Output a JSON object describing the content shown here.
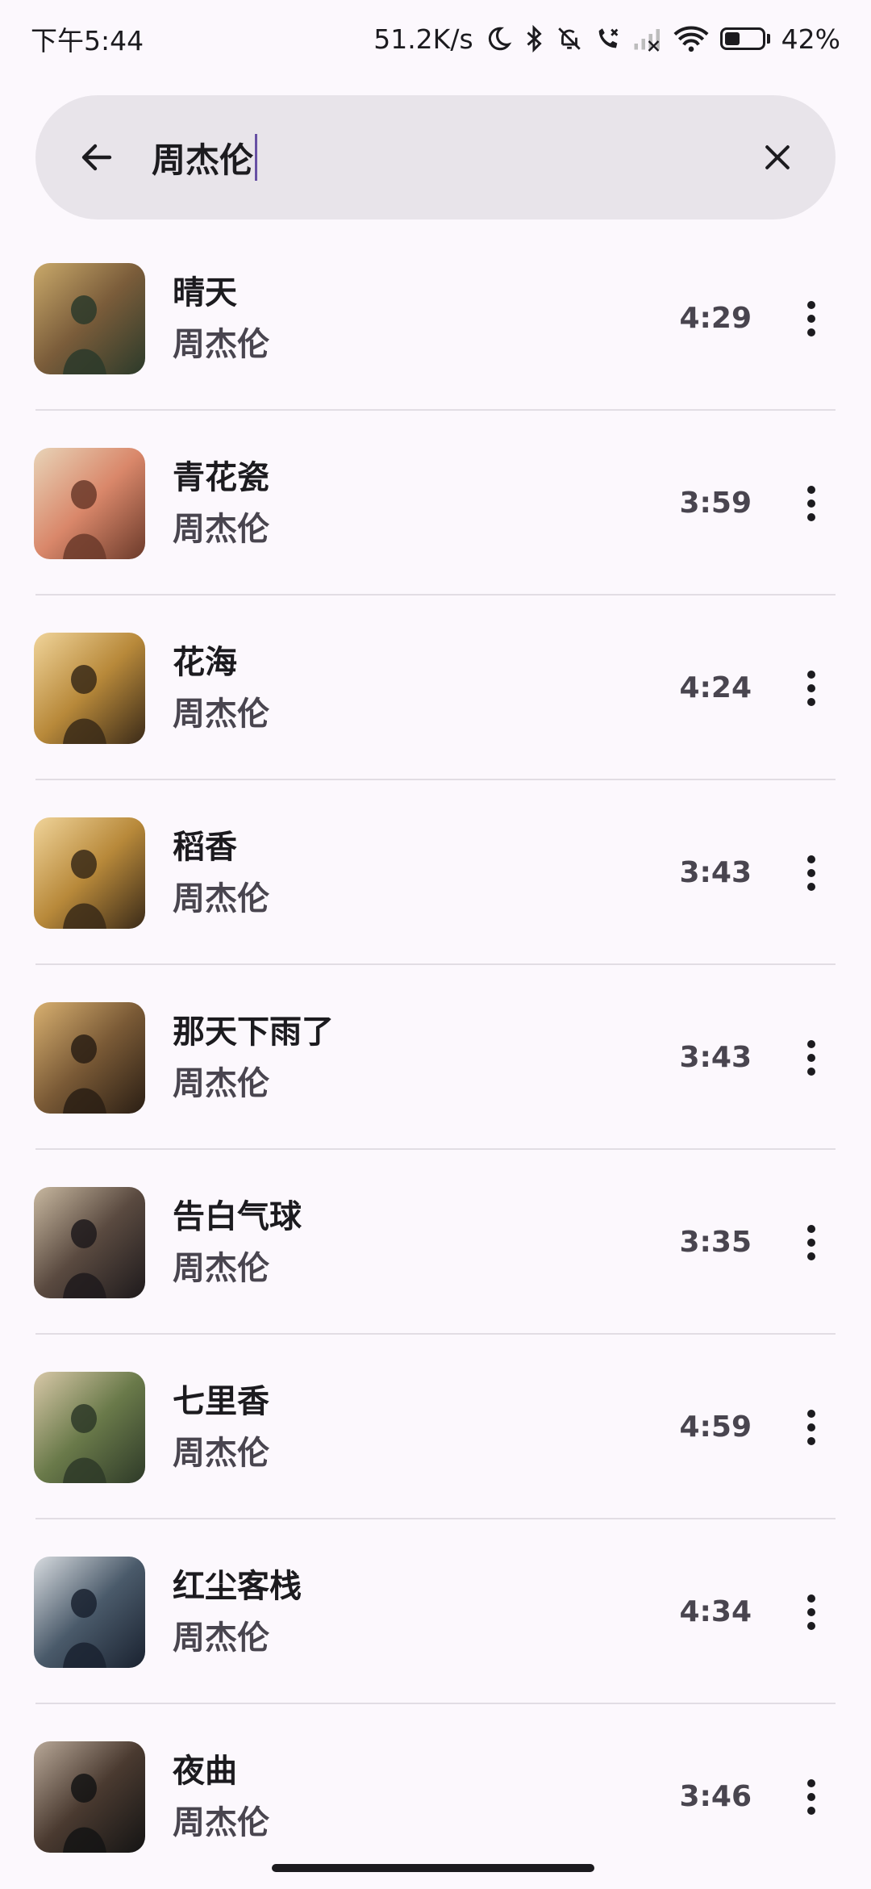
{
  "status_bar": {
    "time": "下午5:44",
    "net_speed": "51.2K/s",
    "battery": "42%",
    "battery_level": 0.42
  },
  "search": {
    "query": "周杰伦"
  },
  "songs": [
    {
      "title": "晴天",
      "artist": "周杰伦",
      "duration": "4:29",
      "cover_colors": [
        "#2b3a2a",
        "#7a5c3a",
        "#c9a96a"
      ]
    },
    {
      "title": "青花瓷",
      "artist": "周杰伦",
      "duration": "3:59",
      "cover_colors": [
        "#6b3a2a",
        "#d9876a",
        "#e8d4b8"
      ]
    },
    {
      "title": "花海",
      "artist": "周杰伦",
      "duration": "4:24",
      "cover_colors": [
        "#3a2a18",
        "#b8893a",
        "#f0d49a"
      ]
    },
    {
      "title": "稻香",
      "artist": "周杰伦",
      "duration": "3:43",
      "cover_colors": [
        "#3a2a18",
        "#b8893a",
        "#f0d49a"
      ]
    },
    {
      "title": "那天下雨了",
      "artist": "周杰伦",
      "duration": "3:43",
      "cover_colors": [
        "#2a1e14",
        "#7a5a36",
        "#d8b070"
      ]
    },
    {
      "title": "告白气球",
      "artist": "周杰伦",
      "duration": "3:35",
      "cover_colors": [
        "#1e1a1c",
        "#5a4a40",
        "#c8b8a0"
      ]
    },
    {
      "title": "七里香",
      "artist": "周杰伦",
      "duration": "4:59",
      "cover_colors": [
        "#2e3a28",
        "#6a7a4a",
        "#d8c8a8"
      ]
    },
    {
      "title": "红尘客栈",
      "artist": "周杰伦",
      "duration": "4:34",
      "cover_colors": [
        "#1a2230",
        "#4a5a6a",
        "#d8dce0"
      ]
    },
    {
      "title": "夜曲",
      "artist": "周杰伦",
      "duration": "3:46",
      "cover_colors": [
        "#141414",
        "#4a3a30",
        "#b8a898"
      ]
    }
  ],
  "icons": {
    "back": "arrow-left-icon",
    "clear": "close-icon",
    "more": "more-vert-icon"
  }
}
